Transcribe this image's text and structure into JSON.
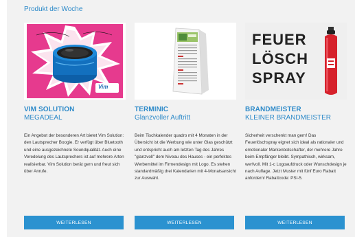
{
  "section": {
    "title": "Produkt der Woche"
  },
  "colors": {
    "accent": "#2d8ac9",
    "button": "#2b92d0",
    "background": "#f2f2f2"
  },
  "cards": [
    {
      "title": "VIM SOLUTION",
      "subtitle": "MEGADEAL",
      "image_icon": "bluetooth-speaker-image",
      "logo_text": "Vim",
      "body": "Ein Angebot der besonderen Art bietet Vim Solution: den Lautsprecher Boogie. Er verfügt über Bluetooth und eine ausgezeichnete Soundqualität. Auch eine Veredelung des Lautsprechers ist auf mehrere Arten realisierbar. Vim Solution berät gern und freut sich über Anrufe.",
      "button": "WEITERLESEN"
    },
    {
      "title": "TERMINIC",
      "subtitle": "Glanzvoller Auftritt",
      "image_icon": "desk-calendar-image",
      "body": "Beim Tischkalender quadro mit 4 Monaten in der Übersicht ist die Werbung wie unter Glas geschützt und entspricht auch am letzten Tag des Jahres \"glanzvoll\" dem Niveau des Hauses - ein perfektes Werbemittel im Firmendesign mit Logo. Es stehen standardmäßig drei Kalendarien mit 4-Monatsansicht zur Auswahl.",
      "button": "WEITERLESEN"
    },
    {
      "title": "BRANDMEISTER",
      "subtitle": "KLEINER BRANDMEISTER",
      "image_icon": "fire-spray-image",
      "image_lines": [
        "FEUER",
        "LÖSCH",
        "SPRAY"
      ],
      "body": "Sicherheit verschenkt man gern! Das Feuerlöschspray eignet sich ideal als rationaler und emotionaler Markenbotschafter, der mehrere Jahre beim Empfänger bleibt. Sympathisch, wirksam, werfvoll. Mit 1-c Logoaufdruck oder Wunschdesign je nach Auflage. Jetzt Muster mit fünf Euro Rabatt anfordern! Rabattcode: PSI-5.",
      "button": "WEITERLESEN"
    }
  ]
}
